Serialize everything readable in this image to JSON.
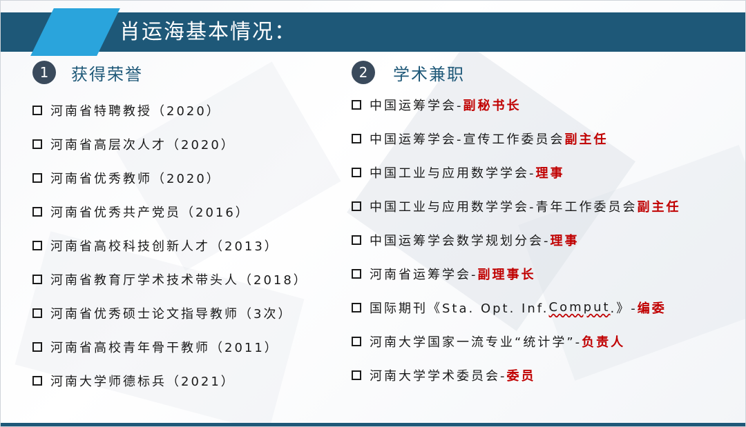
{
  "title": "肖运海基本情况：",
  "sections": {
    "honors": {
      "number": "1",
      "heading": "获得荣誉",
      "items": [
        "河南省特聘教授（2020）",
        "河南省高层次人才（2020）",
        "河南省优秀教师（2020）",
        "河南省优秀共产党员（2016）",
        "河南省高校科技创新人才（2013）",
        "河南省教育厅学术技术带头人（2018）",
        "河南省优秀硕士论文指导教师（3次）",
        "河南省高校青年骨干教师（2011）",
        "河南大学师德标兵（2021）"
      ]
    },
    "positions": {
      "number": "2",
      "heading": "学术兼职",
      "items": [
        {
          "org": "中国运筹学会-",
          "role": "副秘书长"
        },
        {
          "org": "中国运筹学会-宣传工作委员会",
          "role": "副主任"
        },
        {
          "org": "中国工业与应用数学学会-",
          "role": "理事"
        },
        {
          "org": "中国工业与应用数学学会-青年工作委员会",
          "role": "副主任"
        },
        {
          "org": "中国运筹学会数学规划分会-",
          "role": "理事"
        },
        {
          "org": "河南省运筹学会-",
          "role": "副理事长"
        },
        {
          "org_pre": "国际期刊《Sta. Opt. Inf. ",
          "org_mark": "Comput",
          "org_post": ".》-",
          "role": "编委"
        },
        {
          "org": "河南大学国家一流专业“统计学”-",
          "role": "负责人"
        },
        {
          "org": "河南大学学术委员会-",
          "role": "委员"
        }
      ]
    }
  },
  "colors": {
    "title_bar": "#1e5878",
    "title_accent": "#2aa4dc",
    "highlight": "#c00000"
  }
}
